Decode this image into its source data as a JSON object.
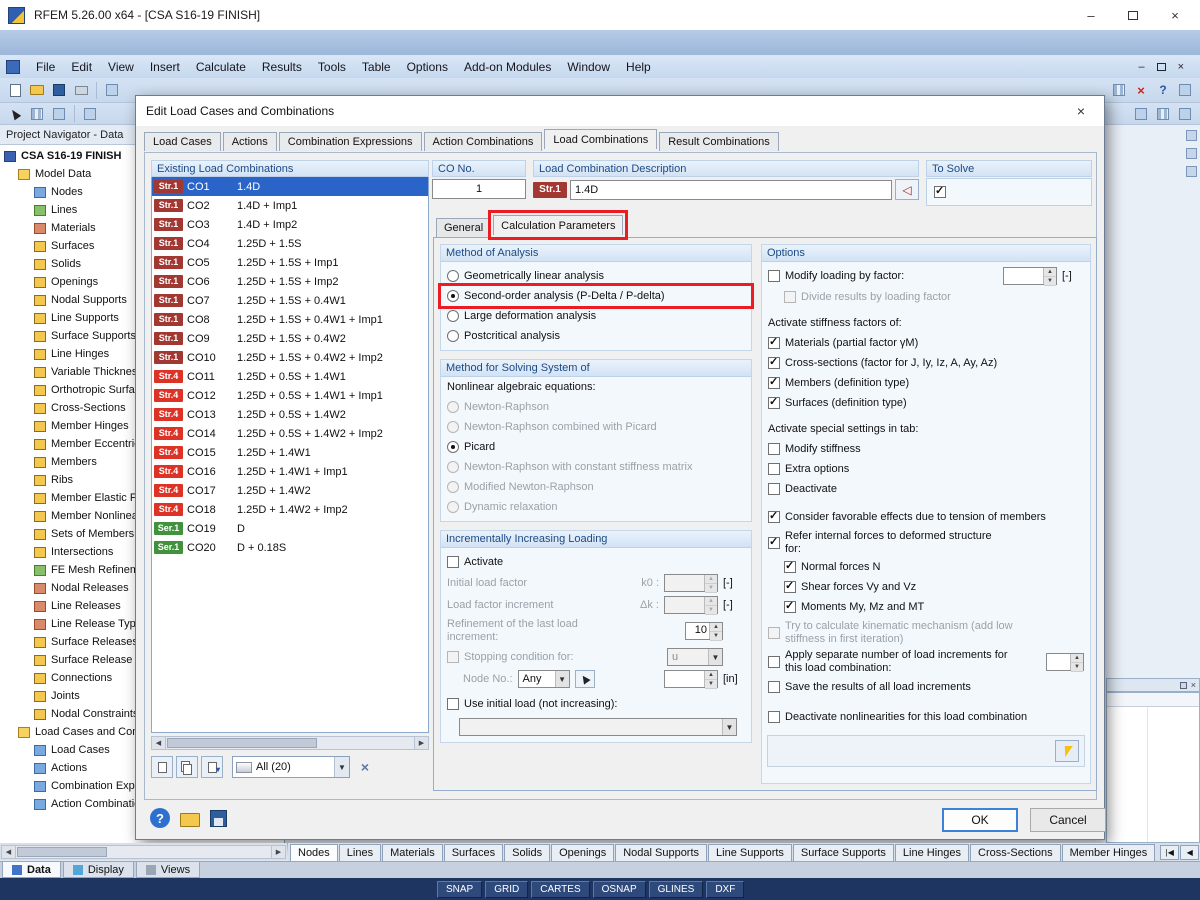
{
  "colors": {
    "annotation_red": "#ec1c24",
    "selection_blue": "#2a64c8",
    "badge_str1": "#a13832",
    "badge_str4": "#dd3226",
    "badge_ser1": "#41913d",
    "statusbar_bg": "#1d3560"
  },
  "titlebar": {
    "title": "RFEM 5.26.00 x64 - [CSA S16-19 FINISH]"
  },
  "menubar": {
    "items": [
      "File",
      "Edit",
      "View",
      "Insert",
      "Calculate",
      "Results",
      "Tools",
      "Table",
      "Options",
      "Add-on Modules",
      "Window",
      "Help"
    ]
  },
  "toolbar_icons": [
    "new-file",
    "open-folder",
    "save",
    "print",
    "import",
    "select-pointer",
    "grid",
    "zoom",
    "guideline",
    "chart",
    "help",
    "close-red",
    "window-box"
  ],
  "navigator": {
    "title": "Project Navigator - Data",
    "tree": [
      {
        "label": "CSA S16-19 FINISH",
        "cls": "lvl0",
        "ico": "ic-root"
      },
      {
        "label": "Model Data",
        "cls": "lvl1",
        "ico": "ic-folder"
      },
      {
        "label": "Nodes",
        "cls": "lvl2",
        "ico": "ic-blue"
      },
      {
        "label": "Lines",
        "cls": "lvl2",
        "ico": "ic-green"
      },
      {
        "label": "Materials",
        "cls": "lvl2",
        "ico": "ic-red"
      },
      {
        "label": "Surfaces",
        "cls": "lvl2",
        "ico": ""
      },
      {
        "label": "Solids",
        "cls": "lvl2",
        "ico": ""
      },
      {
        "label": "Openings",
        "cls": "lvl2",
        "ico": ""
      },
      {
        "label": "Nodal Supports",
        "cls": "lvl2",
        "ico": ""
      },
      {
        "label": "Line Supports",
        "cls": "lvl2",
        "ico": ""
      },
      {
        "label": "Surface Supports",
        "cls": "lvl2",
        "ico": ""
      },
      {
        "label": "Line Hinges",
        "cls": "lvl2",
        "ico": ""
      },
      {
        "label": "Variable Thicknesses",
        "cls": "lvl2",
        "ico": ""
      },
      {
        "label": "Orthotropic Surfaces",
        "cls": "lvl2",
        "ico": ""
      },
      {
        "label": "Cross-Sections",
        "cls": "lvl2",
        "ico": ""
      },
      {
        "label": "Member Hinges",
        "cls": "lvl2",
        "ico": ""
      },
      {
        "label": "Member Eccentricities",
        "cls": "lvl2",
        "ico": ""
      },
      {
        "label": "Members",
        "cls": "lvl2",
        "ico": ""
      },
      {
        "label": "Ribs",
        "cls": "lvl2",
        "ico": ""
      },
      {
        "label": "Member Elastic Foundations",
        "cls": "lvl2",
        "ico": ""
      },
      {
        "label": "Member Nonlinearities",
        "cls": "lvl2",
        "ico": ""
      },
      {
        "label": "Sets of Members",
        "cls": "lvl2",
        "ico": ""
      },
      {
        "label": "Intersections",
        "cls": "lvl2",
        "ico": ""
      },
      {
        "label": "FE Mesh Refinements",
        "cls": "lvl2",
        "ico": "ic-green"
      },
      {
        "label": "Nodal Releases",
        "cls": "lvl2",
        "ico": "ic-red"
      },
      {
        "label": "Line Releases",
        "cls": "lvl2",
        "ico": "ic-red"
      },
      {
        "label": "Line Release Types",
        "cls": "lvl2",
        "ico": "ic-red"
      },
      {
        "label": "Surface Releases",
        "cls": "lvl2",
        "ico": ""
      },
      {
        "label": "Surface Release Types",
        "cls": "lvl2",
        "ico": ""
      },
      {
        "label": "Connections",
        "cls": "lvl2",
        "ico": ""
      },
      {
        "label": "Joints",
        "cls": "lvl2",
        "ico": ""
      },
      {
        "label": "Nodal Constraints",
        "cls": "lvl2",
        "ico": ""
      },
      {
        "label": "Load Cases and Combinations",
        "cls": "lvl1",
        "ico": "ic-folder"
      },
      {
        "label": "Load Cases",
        "cls": "lvl2",
        "ico": "ic-blue"
      },
      {
        "label": "Actions",
        "cls": "lvl2",
        "ico": "ic-blue"
      },
      {
        "label": "Combination Expressions",
        "cls": "lvl2",
        "ico": "ic-blue"
      },
      {
        "label": "Action Combinations",
        "cls": "lvl2",
        "ico": "ic-blue"
      }
    ],
    "panel_tabs": [
      {
        "label": "Data",
        "cls": "active",
        "ico": "pt-data"
      },
      {
        "label": "Display",
        "cls": "",
        "ico": "pt-display"
      },
      {
        "label": "Views",
        "cls": "",
        "ico": "pt-views"
      }
    ]
  },
  "dialog": {
    "title": "Edit Load Cases and Combinations",
    "tabs": [
      {
        "label": "Load Cases",
        "cls": ""
      },
      {
        "label": "Actions",
        "cls": ""
      },
      {
        "label": "Combination Expressions",
        "cls": ""
      },
      {
        "label": "Action Combinations",
        "cls": ""
      },
      {
        "label": "Load Combinations",
        "cls": "active"
      },
      {
        "label": "Result Combinations",
        "cls": ""
      }
    ],
    "existing": {
      "header": "Existing Load Combinations",
      "rows": [
        {
          "badge": "Str.1",
          "bcls": "str1",
          "no": "CO1",
          "desc": "1.4D",
          "cls": "sel"
        },
        {
          "badge": "Str.1",
          "bcls": "str1",
          "no": "CO2",
          "desc": "1.4D + Imp1",
          "cls": ""
        },
        {
          "badge": "Str.1",
          "bcls": "str1",
          "no": "CO3",
          "desc": "1.4D + Imp2",
          "cls": ""
        },
        {
          "badge": "Str.1",
          "bcls": "str1",
          "no": "CO4",
          "desc": "1.25D + 1.5S",
          "cls": ""
        },
        {
          "badge": "Str.1",
          "bcls": "str1",
          "no": "CO5",
          "desc": "1.25D + 1.5S + Imp1",
          "cls": ""
        },
        {
          "badge": "Str.1",
          "bcls": "str1",
          "no": "CO6",
          "desc": "1.25D + 1.5S + Imp2",
          "cls": ""
        },
        {
          "badge": "Str.1",
          "bcls": "str1",
          "no": "CO7",
          "desc": "1.25D + 1.5S + 0.4W1",
          "cls": ""
        },
        {
          "badge": "Str.1",
          "bcls": "str1",
          "no": "CO8",
          "desc": "1.25D + 1.5S + 0.4W1 + Imp1",
          "cls": ""
        },
        {
          "badge": "Str.1",
          "bcls": "str1",
          "no": "CO9",
          "desc": "1.25D + 1.5S + 0.4W2",
          "cls": ""
        },
        {
          "badge": "Str.1",
          "bcls": "str1",
          "no": "CO10",
          "desc": "1.25D + 1.5S + 0.4W2 + Imp2",
          "cls": ""
        },
        {
          "badge": "Str.4",
          "bcls": "str4",
          "no": "CO11",
          "desc": "1.25D + 0.5S + 1.4W1",
          "cls": ""
        },
        {
          "badge": "Str.4",
          "bcls": "str4",
          "no": "CO12",
          "desc": "1.25D + 0.5S + 1.4W1 + Imp1",
          "cls": ""
        },
        {
          "badge": "Str.4",
          "bcls": "str4",
          "no": "CO13",
          "desc": "1.25D + 0.5S + 1.4W2",
          "cls": ""
        },
        {
          "badge": "Str.4",
          "bcls": "str4",
          "no": "CO14",
          "desc": "1.25D + 0.5S + 1.4W2 + Imp2",
          "cls": ""
        },
        {
          "badge": "Str.4",
          "bcls": "str4",
          "no": "CO15",
          "desc": "1.25D + 1.4W1",
          "cls": ""
        },
        {
          "badge": "Str.4",
          "bcls": "str4",
          "no": "CO16",
          "desc": "1.25D + 1.4W1 + Imp1",
          "cls": ""
        },
        {
          "badge": "Str.4",
          "bcls": "str4",
          "no": "CO17",
          "desc": "1.25D + 1.4W2",
          "cls": ""
        },
        {
          "badge": "Str.4",
          "bcls": "str4",
          "no": "CO18",
          "desc": "1.25D + 1.4W2 + Imp2",
          "cls": ""
        },
        {
          "badge": "Ser.1",
          "bcls": "ser1",
          "no": "CO19",
          "desc": "D",
          "cls": ""
        },
        {
          "badge": "Ser.1",
          "bcls": "ser1",
          "no": "CO20",
          "desc": "D + 0.18S",
          "cls": ""
        }
      ],
      "filter_value": "All (20)"
    },
    "co_no": {
      "header": "CO No.",
      "value": "1"
    },
    "description": {
      "header": "Load Combination Description",
      "badge": "Str.1",
      "value": "1.4D"
    },
    "to_solve": {
      "header": "To Solve"
    },
    "subtabs": [
      {
        "label": "General",
        "cls": ""
      },
      {
        "label": "Calculation Parameters",
        "cls": "active hl"
      }
    ],
    "method_of_analysis": {
      "header": "Method of Analysis",
      "options": [
        {
          "label": "Geometrically linear analysis",
          "cls": ""
        },
        {
          "label": "Second-order analysis (P-Delta / P-delta)",
          "cls": "on hl"
        },
        {
          "label": "Large deformation analysis",
          "cls": ""
        },
        {
          "label": "Postcritical analysis",
          "cls": ""
        }
      ]
    },
    "solver": {
      "header": "Method for Solving System of",
      "sublabel": "Nonlinear algebraic equations:",
      "options": [
        {
          "label": "Newton-Raphson",
          "cls": "dis"
        },
        {
          "label": "Newton-Raphson combined with Picard",
          "cls": "dis"
        },
        {
          "label": "Picard",
          "cls": "on"
        },
        {
          "label": "Newton-Raphson with constant stiffness matrix",
          "cls": "dis"
        },
        {
          "label": "Modified Newton-Raphson",
          "cls": "dis"
        },
        {
          "label": "Dynamic relaxation",
          "cls": "dis"
        }
      ]
    },
    "incremental": {
      "header": "Incrementally Increasing Loading",
      "activate": "Activate",
      "initial_load_factor": "Initial load factor",
      "k0": "k0 :",
      "load_factor_increment": "Load factor increment",
      "dk": "Δk :",
      "refinement": "Refinement of the last load increment:",
      "refinement_value": "10",
      "stopping": "Stopping condition for:",
      "stopping_value": "u",
      "node_no": "Node No.:",
      "node_no_value": "Any",
      "use_initial": "Use initial load (not increasing):",
      "unit_dimensionless": "[-]",
      "unit_length": "[in]"
    },
    "options_panel": {
      "header": "Options",
      "modify_loading": "Modify loading by factor:",
      "unit_dimensionless": "[-]",
      "divide_results": "Divide results by loading factor",
      "stiffness_title": "Activate stiffness factors of:",
      "stiffness_checks": [
        {
          "label": "Materials (partial factor γM)",
          "cls": "on"
        },
        {
          "label": "Cross-sections (factor for J, Iy, Iz, A, Ay, Az)",
          "cls": "on"
        },
        {
          "label": "Members (definition type)",
          "cls": "on"
        },
        {
          "label": "Surfaces (definition type)",
          "cls": "on"
        }
      ],
      "special_title": "Activate special settings in tab:",
      "special_checks": [
        {
          "label": "Modify stiffness",
          "cls": ""
        },
        {
          "label": "Extra options",
          "cls": ""
        },
        {
          "label": "Deactivate",
          "cls": ""
        }
      ],
      "favorable": "Consider favorable effects due to tension of members",
      "refer": "Refer internal forces to deformed structure for:",
      "refer_checks": [
        {
          "label": "Normal forces N",
          "cls": "on"
        },
        {
          "label": "Shear forces Vy and Vz",
          "cls": "on"
        },
        {
          "label": "Moments My, Mz and MT",
          "cls": "on"
        }
      ],
      "kinematic": "Try to calculate kinematic mechanism (add low stiffness in first iteration)",
      "apply_separate": "Apply separate number of load increments for this load combination:",
      "save_results": "Save the results of all load increments",
      "deactivate_nonlin": "Deactivate nonlinearities for this load combination"
    },
    "buttons": {
      "ok": "OK",
      "cancel": "Cancel"
    }
  },
  "bottom_tabs": [
    {
      "label": "Nodes",
      "cls": "active"
    },
    {
      "label": "Lines",
      "cls": ""
    },
    {
      "label": "Materials",
      "cls": ""
    },
    {
      "label": "Surfaces",
      "cls": ""
    },
    {
      "label": "Solids",
      "cls": ""
    },
    {
      "label": "Openings",
      "cls": ""
    },
    {
      "label": "Nodal Supports",
      "cls": ""
    },
    {
      "label": "Line Supports",
      "cls": ""
    },
    {
      "label": "Surface Supports",
      "cls": ""
    },
    {
      "label": "Line Hinges",
      "cls": ""
    },
    {
      "label": "Cross-Sections",
      "cls": ""
    },
    {
      "label": "Member Hinges",
      "cls": ""
    }
  ],
  "tab_nav": [
    "|◀",
    "◀",
    "▶",
    "▶|"
  ],
  "statusbar": {
    "buttons": [
      {
        "label": "SNAP"
      },
      {
        "label": "GRID"
      },
      {
        "label": "CARTES"
      },
      {
        "label": "OSNAP"
      },
      {
        "label": "GLINES"
      },
      {
        "label": "DXF"
      }
    ]
  }
}
